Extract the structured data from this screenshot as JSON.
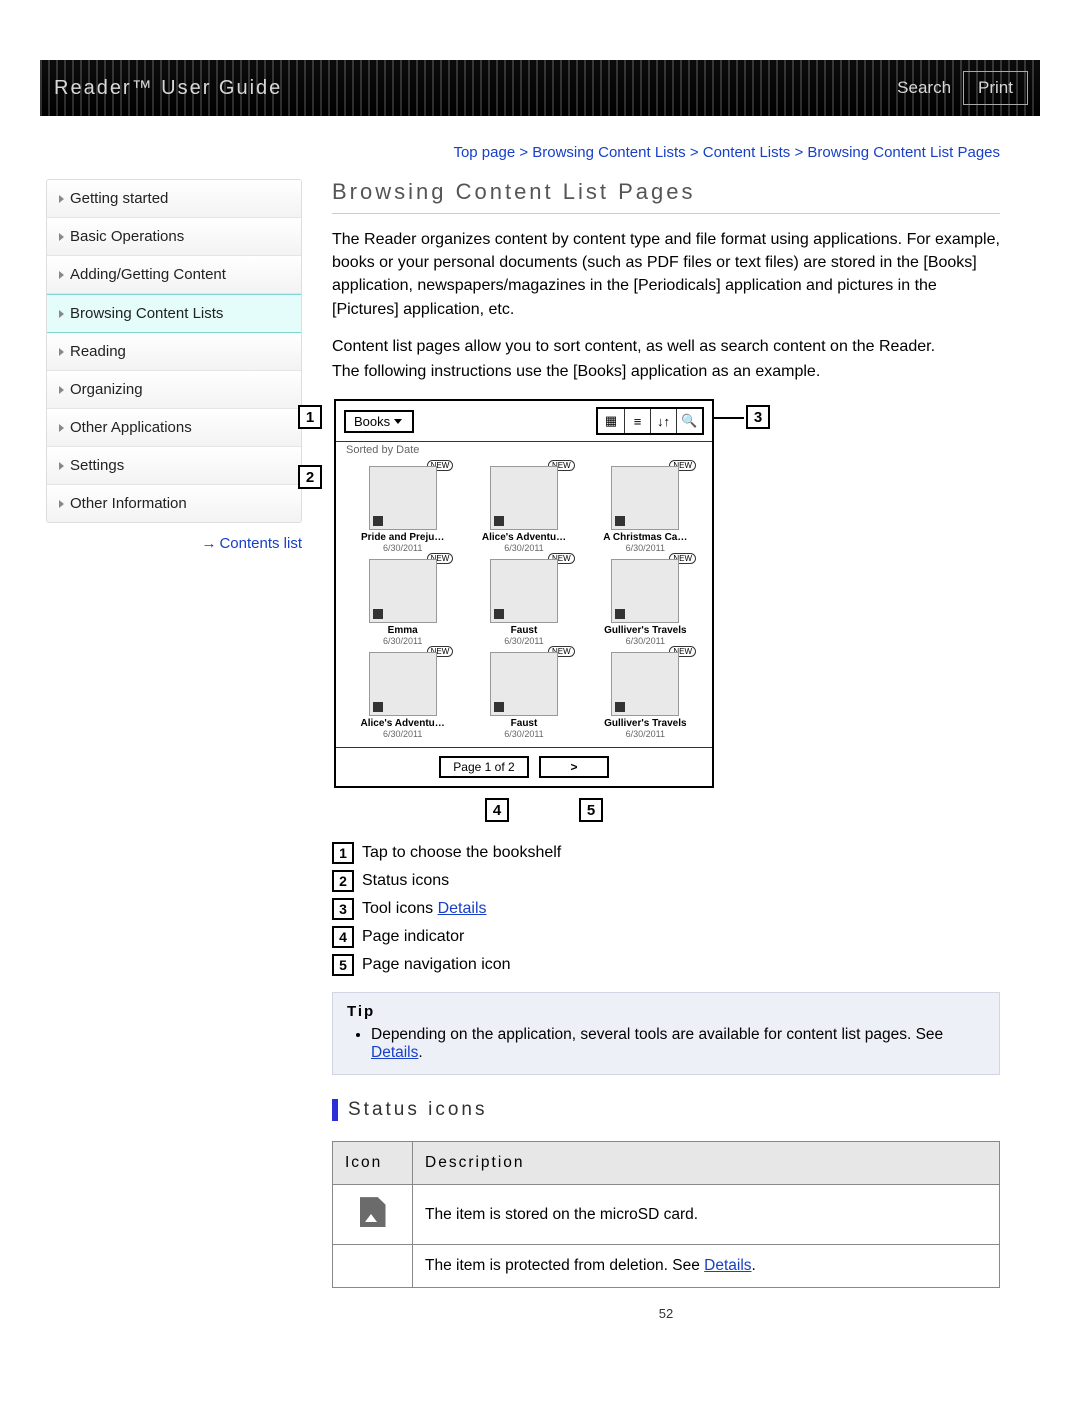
{
  "header": {
    "title": "Reader™ User Guide",
    "search_label": "Search",
    "print_label": "Print"
  },
  "breadcrumb": "Top page > Browsing Content Lists > Content Lists > Browsing Content List Pages",
  "sidebar": {
    "items": [
      {
        "label": "Getting started"
      },
      {
        "label": "Basic Operations"
      },
      {
        "label": "Adding/Getting Content"
      },
      {
        "label": "Browsing Content Lists"
      },
      {
        "label": "Reading"
      },
      {
        "label": "Organizing"
      },
      {
        "label": "Other Applications"
      },
      {
        "label": "Settings"
      },
      {
        "label": "Other Information"
      }
    ],
    "contents_list_label": "Contents list"
  },
  "main": {
    "title": "Browsing Content List Pages",
    "para1": "The Reader organizes content by content type and file format using applications. For example, books or your personal documents (such as PDF files or text files) are stored in the [Books] application, newspapers/magazines in the [Periodicals] application and pictures in the [Pictures] application, etc.",
    "para2": "Content list pages allow you to sort content, as well as search content on the Reader.",
    "para3": "The following instructions use the [Books] application as an example.",
    "device": {
      "dropdown_label": "Books",
      "sorted_label": "Sorted by Date",
      "tool_icons": [
        "grid",
        "list",
        "sort",
        "search"
      ],
      "books": [
        {
          "title": "Pride and Preju…",
          "date": "6/30/2011"
        },
        {
          "title": "Alice's Adventu…",
          "date": "6/30/2011"
        },
        {
          "title": "A Christmas Ca…",
          "date": "6/30/2011"
        },
        {
          "title": "Emma",
          "date": "6/30/2011"
        },
        {
          "title": "Faust",
          "date": "6/30/2011"
        },
        {
          "title": "Gulliver's Travels",
          "date": "6/30/2011"
        },
        {
          "title": "Alice's Adventu…",
          "date": "6/30/2011"
        },
        {
          "title": "Faust",
          "date": "6/30/2011"
        },
        {
          "title": "Gulliver's Travels",
          "date": "6/30/2011"
        }
      ],
      "page_indicator": "Page 1 of 2",
      "next_icon": ">"
    },
    "callouts": {
      "c1": "1",
      "c2": "2",
      "c3": "3",
      "c4": "4",
      "c5": "5"
    },
    "legend": [
      {
        "num": "1",
        "text": "Tap to choose the bookshelf"
      },
      {
        "num": "2",
        "text": "Status icons"
      },
      {
        "num": "3",
        "text": "Tool icons ",
        "link": "Details"
      },
      {
        "num": "4",
        "text": "Page indicator"
      },
      {
        "num": "5",
        "text": "Page navigation icon"
      }
    ],
    "tip": {
      "title": "Tip",
      "item_text": "Depending on the application, several tools are available for content list pages. See ",
      "item_link": "Details",
      "period": "."
    },
    "subhead": "Status icons",
    "table": {
      "headers": [
        "Icon",
        "Description"
      ],
      "rows": [
        {
          "icon": "sd",
          "desc": "The item is stored on the microSD card."
        },
        {
          "icon": "",
          "desc_pre": "The item is protected from deletion. See ",
          "desc_link": "Details",
          "desc_post": "."
        }
      ]
    },
    "page_number": "52"
  }
}
